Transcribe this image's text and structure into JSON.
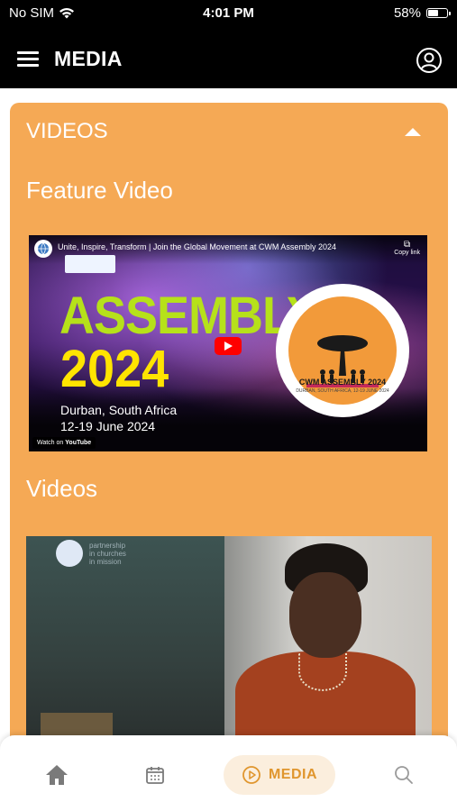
{
  "status_bar": {
    "carrier": "No SIM",
    "time": "4:01 PM",
    "battery": "58%",
    "battery_level": 0.58
  },
  "app_bar": {
    "title": "MEDIA",
    "menu_icon": "hamburger-menu-icon",
    "account_icon": "user-account-icon"
  },
  "section": {
    "title": "VIDEOS",
    "expanded": true
  },
  "feature": {
    "heading": "Feature Video",
    "video": {
      "title": "Unite, Inspire, Transform | Join the Global Movement at CWM Assembly 2024",
      "copy_link": "Copy link",
      "headline": "ASSEMBLY",
      "year": "2024",
      "location": "Durban, South Africa",
      "dates": "12-19 June 2024",
      "logo_text": "CWM ASSEMBLY 2024",
      "logo_sub": "DURBAN, SOUTH AFRICA, 12-19 JUNE 2024",
      "watch_on": "Watch on",
      "platform": "YouTube"
    }
  },
  "videos": {
    "heading": "Videos",
    "items": [
      {
        "channel_text": "partnership\nin churches\nin mission"
      }
    ]
  },
  "tab_bar": {
    "tabs": [
      {
        "name": "home",
        "icon": "home-icon"
      },
      {
        "name": "calendar",
        "icon": "calendar-icon"
      },
      {
        "name": "media",
        "icon": "play-circle-icon",
        "label": "MEDIA",
        "active": true
      },
      {
        "name": "search",
        "icon": "search-icon"
      }
    ]
  },
  "colors": {
    "panel": "#f5a955",
    "accent": "#e0962e",
    "header": "#000000"
  }
}
